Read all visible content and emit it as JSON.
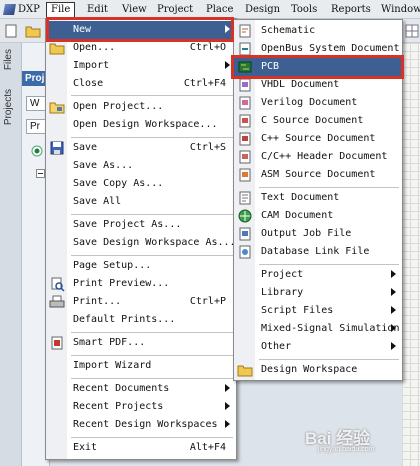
{
  "menubar": {
    "items": [
      "DXP",
      "File",
      "Edit",
      "View",
      "Project",
      "Place",
      "Design",
      "Tools",
      "Reports",
      "Window"
    ]
  },
  "panel": {
    "tabs": [
      "Files",
      "Projects"
    ],
    "header": "Proj",
    "boxes": [
      "W",
      "Pr"
    ]
  },
  "file_menu": {
    "items": [
      {
        "label": "New",
        "shortcut": "",
        "submenu": true,
        "icon": "none",
        "highlight": true
      },
      {
        "label": "Open...",
        "shortcut": "Ctrl+O",
        "submenu": false,
        "icon": "open-folder-icon"
      },
      {
        "label": "Import",
        "shortcut": "",
        "submenu": true,
        "icon": "none"
      },
      {
        "label": "Close",
        "shortcut": "Ctrl+F4",
        "submenu": false,
        "icon": "none"
      },
      {
        "label": "Open Project...",
        "shortcut": "",
        "submenu": false,
        "icon": "open-project-icon"
      },
      {
        "label": "Open Design Workspace...",
        "shortcut": "",
        "submenu": false,
        "icon": "none"
      },
      {
        "label": "Save",
        "shortcut": "Ctrl+S",
        "submenu": false,
        "icon": "save-icon"
      },
      {
        "label": "Save As...",
        "shortcut": "",
        "submenu": false,
        "icon": "none"
      },
      {
        "label": "Save Copy As...",
        "shortcut": "",
        "submenu": false,
        "icon": "none"
      },
      {
        "label": "Save All",
        "shortcut": "",
        "submenu": false,
        "icon": "save-all-icon"
      },
      {
        "label": "Save Project As...",
        "shortcut": "",
        "submenu": false,
        "icon": "none"
      },
      {
        "label": "Save Design Workspace As...",
        "shortcut": "",
        "submenu": false,
        "icon": "none"
      },
      {
        "label": "Page Setup...",
        "shortcut": "",
        "submenu": false,
        "icon": "none"
      },
      {
        "label": "Print Preview...",
        "shortcut": "",
        "submenu": false,
        "icon": "print-preview-icon"
      },
      {
        "label": "Print...",
        "shortcut": "Ctrl+P",
        "submenu": false,
        "icon": "print-icon"
      },
      {
        "label": "Default Prints...",
        "shortcut": "",
        "submenu": false,
        "icon": "none"
      },
      {
        "label": "Smart PDF...",
        "shortcut": "",
        "submenu": false,
        "icon": "smart-pdf-icon"
      },
      {
        "label": "Import Wizard",
        "shortcut": "",
        "submenu": false,
        "icon": "none"
      },
      {
        "label": "Recent Documents",
        "shortcut": "",
        "submenu": true,
        "icon": "none"
      },
      {
        "label": "Recent Projects",
        "shortcut": "",
        "submenu": true,
        "icon": "none"
      },
      {
        "label": "Recent Design Workspaces",
        "shortcut": "",
        "submenu": true,
        "icon": "none"
      },
      {
        "label": "Exit",
        "shortcut": "Alt+F4",
        "submenu": false,
        "icon": "none"
      }
    ]
  },
  "new_menu": {
    "items": [
      {
        "label": "Schematic",
        "submenu": false,
        "icon": "schematic-doc-icon"
      },
      {
        "label": "OpenBus System Document",
        "submenu": false,
        "icon": "openbus-doc-icon"
      },
      {
        "label": "PCB",
        "submenu": false,
        "icon": "pcb-doc-icon",
        "highlight": true
      },
      {
        "label": "VHDL Document",
        "submenu": false,
        "icon": "vhdl-doc-icon"
      },
      {
        "label": "Verilog Document",
        "submenu": false,
        "icon": "verilog-doc-icon"
      },
      {
        "label": "C Source Document",
        "submenu": false,
        "icon": "c-source-doc-icon"
      },
      {
        "label": "C++ Source Document",
        "submenu": false,
        "icon": "cpp-source-doc-icon"
      },
      {
        "label": "C/C++ Header Document",
        "submenu": false,
        "icon": "header-doc-icon"
      },
      {
        "label": "ASM Source Document",
        "submenu": false,
        "icon": "asm-doc-icon"
      },
      {
        "label": "Text Document",
        "submenu": false,
        "icon": "text-doc-icon"
      },
      {
        "label": "CAM Document",
        "submenu": false,
        "icon": "cam-doc-icon"
      },
      {
        "label": "Output Job File",
        "submenu": false,
        "icon": "output-job-icon"
      },
      {
        "label": "Database Link File",
        "submenu": false,
        "icon": "database-link-icon"
      },
      {
        "label": "Project",
        "submenu": true,
        "icon": "none"
      },
      {
        "label": "Library",
        "submenu": true,
        "icon": "none"
      },
      {
        "label": "Script Files",
        "submenu": true,
        "icon": "none"
      },
      {
        "label": "Mixed-Signal Simulation",
        "submenu": true,
        "icon": "none"
      },
      {
        "label": "Other",
        "submenu": true,
        "icon": "none"
      },
      {
        "label": "Design Workspace",
        "submenu": false,
        "icon": "design-workspace-icon"
      }
    ]
  },
  "watermark": {
    "text": "Bai 经验",
    "sub": "jingyan.baidu.com"
  },
  "colors": {
    "highlight": "#3e5f91",
    "annotation_red": "#d63228"
  }
}
